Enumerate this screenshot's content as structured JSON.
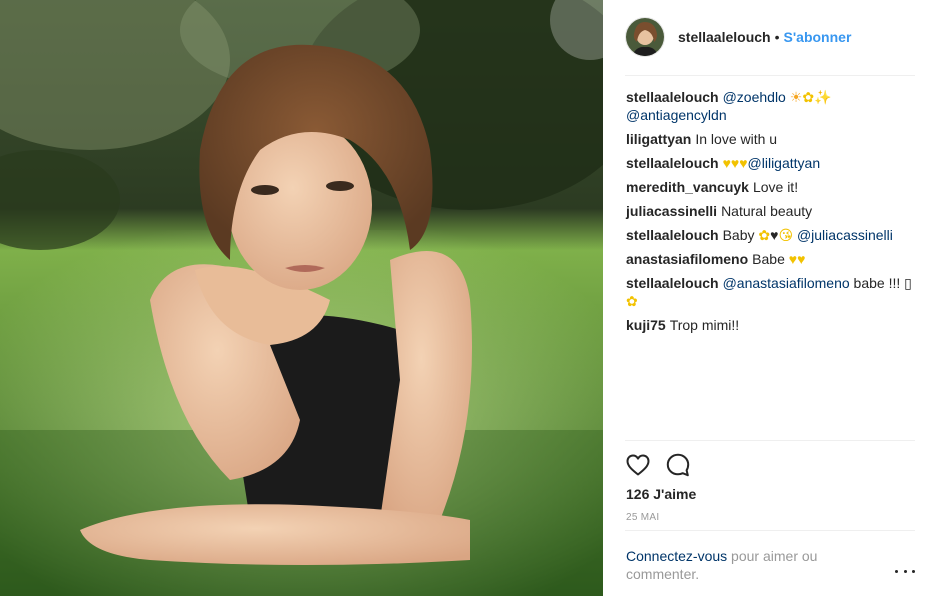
{
  "post": {
    "author": "stellaalelouch",
    "separator": "•",
    "follow_label": "S'abonner",
    "photo_icon": "portrait-photo",
    "avatar_icon": "profile-avatar"
  },
  "comments": [
    {
      "author": "stellaalelouch",
      "parts": [
        {
          "type": "mention",
          "text": "@zoehdlo"
        },
        {
          "type": "text",
          "text": " "
        },
        {
          "type": "emoji-sun",
          "text": "☀"
        },
        {
          "type": "emoji",
          "text": "✿"
        },
        {
          "type": "emoji",
          "text": "✨"
        },
        {
          "type": "text",
          "text": " "
        },
        {
          "type": "mention",
          "text": "@antiagencyldn"
        }
      ]
    },
    {
      "author": "liligattyan",
      "parts": [
        {
          "type": "text",
          "text": "In love with u"
        }
      ]
    },
    {
      "author": "stellaalelouch",
      "parts": [
        {
          "type": "emoji",
          "text": "♥♥♥"
        },
        {
          "type": "mention",
          "text": "@liligattyan"
        }
      ]
    },
    {
      "author": "meredith_vancuyk",
      "parts": [
        {
          "type": "text",
          "text": "Love it!"
        }
      ]
    },
    {
      "author": "juliacassinelli",
      "parts": [
        {
          "type": "text",
          "text": "Natural beauty"
        }
      ]
    },
    {
      "author": "stellaalelouch",
      "parts": [
        {
          "type": "text",
          "text": "Baby "
        },
        {
          "type": "emoji",
          "text": "✿"
        },
        {
          "type": "emoji-dark",
          "text": "♥"
        },
        {
          "type": "emoji",
          "text": "😘"
        },
        {
          "type": "text",
          "text": " "
        },
        {
          "type": "mention",
          "text": "@juliacassinelli"
        }
      ]
    },
    {
      "author": "anastasiafilomeno",
      "parts": [
        {
          "type": "text",
          "text": "Babe "
        },
        {
          "type": "emoji",
          "text": "♥♥"
        }
      ]
    },
    {
      "author": "stellaalelouch",
      "parts": [
        {
          "type": "mention",
          "text": "@anastasiafilomeno"
        },
        {
          "type": "text",
          "text": " babe !!! ▯ "
        },
        {
          "type": "emoji",
          "text": "✿"
        }
      ]
    },
    {
      "author": "kuji75",
      "parts": [
        {
          "type": "text",
          "text": "Trop mimi!!"
        }
      ]
    }
  ],
  "actions": {
    "like_icon": "heart-outline-icon",
    "comment_icon": "comment-bubble-icon"
  },
  "likes_text": "126 J'aime",
  "date_text": "25 MAI",
  "login_prompt": {
    "link": "Connectez-vous",
    "rest": " pour aimer ou commenter."
  },
  "more_icon": "more-options-icon"
}
